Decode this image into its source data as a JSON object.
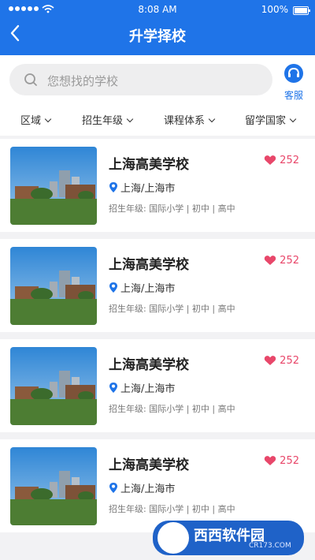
{
  "status_bar": {
    "time": "8:08 AM",
    "battery": "100%"
  },
  "header": {
    "title": "升学择校"
  },
  "search": {
    "placeholder": "您想找的学校",
    "service_label": "客服"
  },
  "filters": [
    "区域",
    "招生年级",
    "课程体系",
    "留学国家"
  ],
  "schools": [
    {
      "name": "上海高美学校",
      "location": "上海/上海市",
      "grades": "招生年级: 国际小学 | 初中 | 高中",
      "likes": "252"
    },
    {
      "name": "上海高美学校",
      "location": "上海/上海市",
      "grades": "招生年级: 国际小学 | 初中 | 高中",
      "likes": "252"
    },
    {
      "name": "上海高美学校",
      "location": "上海/上海市",
      "grades": "招生年级: 国际小学 | 初中 | 高中",
      "likes": "252"
    },
    {
      "name": "上海高美学校",
      "location": "上海/上海市",
      "grades": "招生年级: 国际小学 | 初中 | 高中",
      "likes": "252"
    }
  ],
  "watermark": {
    "text": "西西软件园",
    "sub": "CR173.COM"
  },
  "colors": {
    "accent": "#1f74e8",
    "like": "#e8476a"
  }
}
